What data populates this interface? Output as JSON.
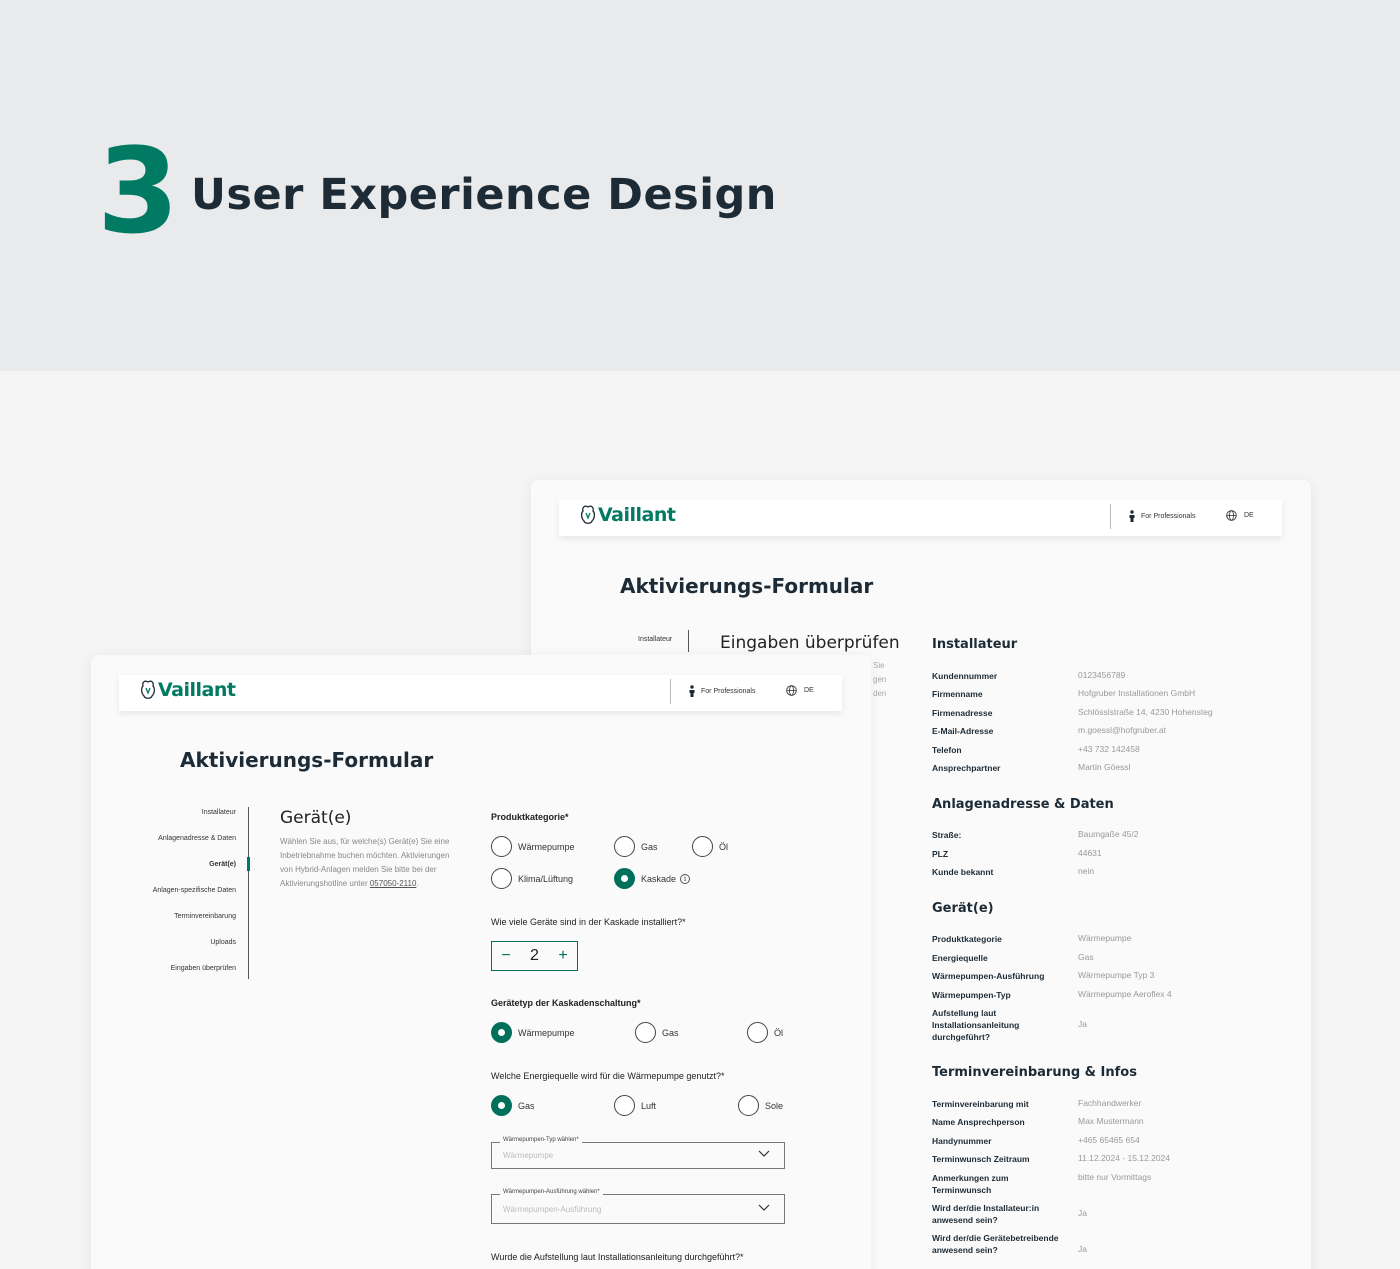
{
  "hero": {
    "number": "3",
    "title": "User Experience Design"
  },
  "brand": {
    "logo": "Vaillant",
    "accent": "#007a63"
  },
  "nav": {
    "professionals": "For Professionals",
    "language": "DE"
  },
  "form_title": "Aktivierungs-Formular",
  "back": {
    "step_label": "Installateur",
    "heading": "Eingaben überprüfen",
    "peek": [
      "Sie",
      "gen",
      "den"
    ],
    "sections": [
      {
        "title": "Installateur",
        "rows": [
          {
            "k": "Kundennummer",
            "v": "0123456789"
          },
          {
            "k": "Firmenname",
            "v": "Hofgruber Installationen GmbH"
          },
          {
            "k": "Firmenadresse",
            "v": "Schlösslstraße 14, 4230 Hohensteg"
          },
          {
            "k": "E-Mail-Adresse",
            "v": "m.goessl@hofgruber.at"
          },
          {
            "k": "Telefon",
            "v": "+43 732 142458"
          },
          {
            "k": "Ansprechpartner",
            "v": "Martin Göessl"
          }
        ]
      },
      {
        "title": "Anlagenadresse & Daten",
        "rows": [
          {
            "k": "Straße:",
            "v": "Baumgaße 45/2"
          },
          {
            "k": "PLZ",
            "v": "44631"
          },
          {
            "k": "Kunde bekannt",
            "v": "nein"
          }
        ]
      },
      {
        "title": "Gerät(e)",
        "rows": [
          {
            "k": "Produktkategorie",
            "v": "Wärmepumpe"
          },
          {
            "k": "Energiequelle",
            "v": "Gas"
          },
          {
            "k": "Wärmepumpen-Ausführung",
            "v": "Wärmepumpe Typ 3"
          },
          {
            "k": "Wärmepumpen-Typ",
            "v": "Wärmepumpe Aeroflex 4"
          },
          {
            "k": "Aufstellung laut Installationsanleitung durchgeführt?",
            "v": "Ja"
          }
        ]
      },
      {
        "title": "Terminvereinbarung & Infos",
        "rows": [
          {
            "k": "Terminvereinbarung mit",
            "v": "Fachhandwerker"
          },
          {
            "k": "Name Ansprechperson",
            "v": "Max Mustermann"
          },
          {
            "k": "Handynummer",
            "v": "+465 65465 654"
          },
          {
            "k": "Terminwunsch Zeitraum",
            "v": "11.12.2024 - 15.12.2024"
          },
          {
            "k": "Anmerkungen zum Terminwunsch",
            "v": "bitte nur Vormittags"
          },
          {
            "k": "Wird der/die Installateur:in anwesend sein?",
            "v": "Ja"
          },
          {
            "k": "Wird der/die Gerätebetreibende anwesend sein?",
            "v": "Ja"
          }
        ]
      }
    ]
  },
  "front": {
    "steps": [
      "Installateur",
      "Anlagenadresse & Daten",
      "Gerät(e)",
      "Anlagen-spezifische Daten",
      "Terminvereinbarung",
      "Uploads",
      "Eingaben überprüfen"
    ],
    "active_step": "Gerät(e)",
    "heading": "Gerät(e)",
    "description": "Wählen Sie aus, für welche(s) Gerät(e) Sie eine Inbetriebnahme buchen möchten. Aktivierungen von Hybrid-Anlagen melden Sie bitte bei der Aktivierungshotline unter",
    "hotline": "057050-2110",
    "q1": {
      "label": "Produktkategorie*",
      "options": [
        "Wärmepumpe",
        "Gas",
        "Öl",
        "Klima/Lüftung",
        "Kaskade"
      ],
      "selected": "Kaskade"
    },
    "q2": {
      "label": "Wie viele Geräte sind in der Kaskade installiert?*",
      "value": "2",
      "minus": "−",
      "plus": "+"
    },
    "q3": {
      "label": "Gerätetyp der Kaskadenschaltung*",
      "options": [
        "Wärmepumpe",
        "Gas",
        "Öl"
      ],
      "selected": "Wärmepumpe"
    },
    "q4": {
      "label": "Welche Energiequelle wird für die Wärmepumpe genutzt?*",
      "options": [
        "Gas",
        "Luft",
        "Sole"
      ],
      "selected": "Gas"
    },
    "select1": {
      "label": "Wärmepumpen-Typ wählen*",
      "placeholder": "Wärmepumpe"
    },
    "select2": {
      "label": "Wärmepumpen-Ausführung wählen*",
      "placeholder": "Wärmepumpen-Ausführung"
    },
    "q5": {
      "label": "Wurde die Aufstellung laut Installationsanleitung durchgeführt?*"
    }
  }
}
